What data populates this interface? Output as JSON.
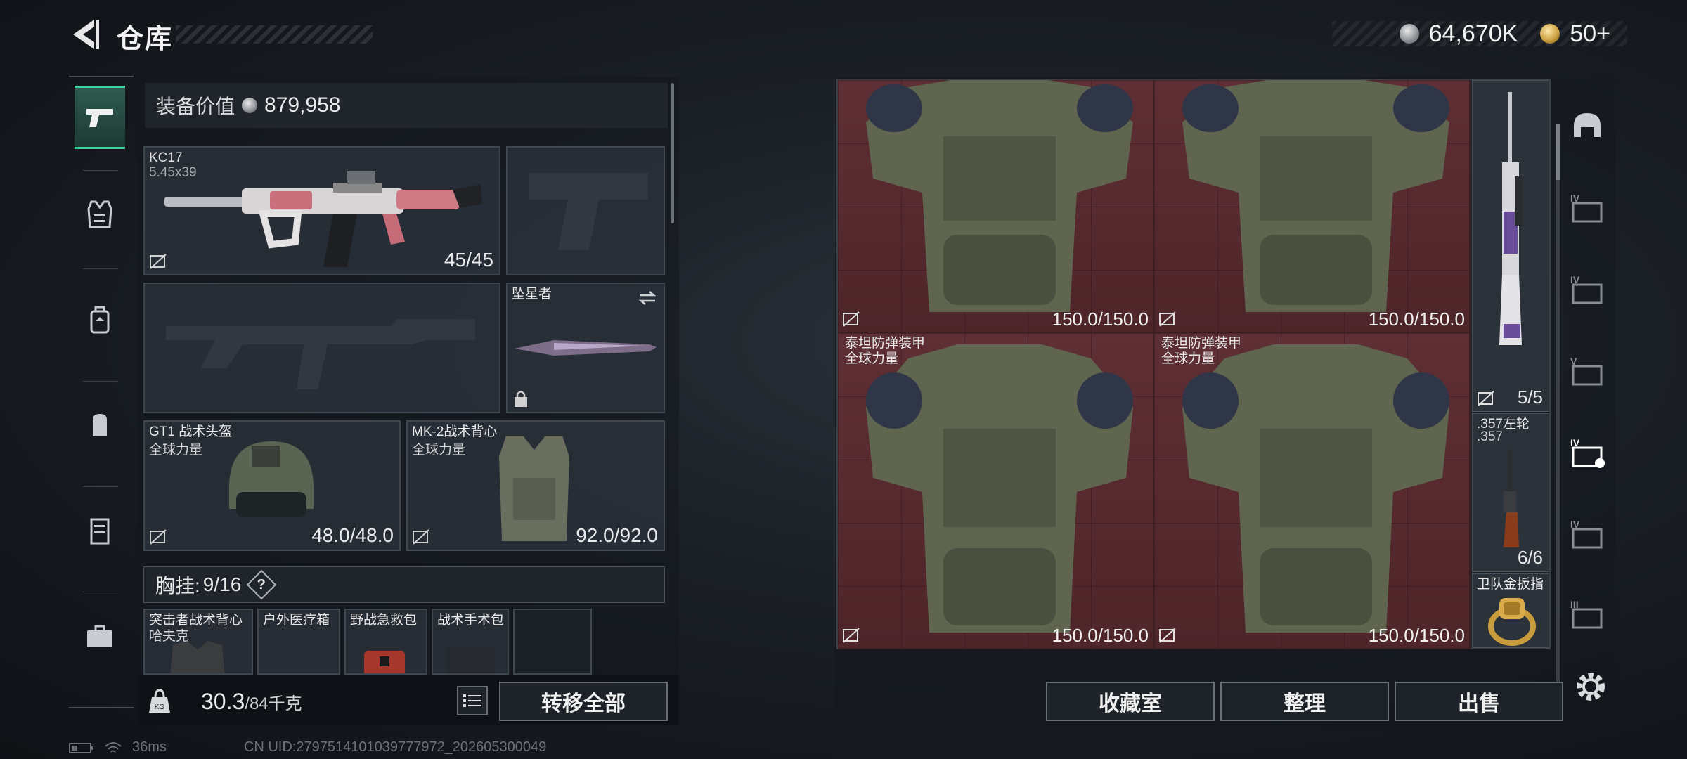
{
  "header": {
    "title": "仓库",
    "currency_silver": "64,670K",
    "currency_gold": "50+"
  },
  "loadout": {
    "value_label": "装备价值",
    "value_amount": "879,958",
    "primary_weapon": {
      "name": "KC17",
      "caliber": "5.45x39",
      "ammo": "45/45"
    },
    "melee": {
      "name": "坠星者"
    },
    "helmet": {
      "name": "GT1 战术头盔",
      "faction": "全球力量",
      "durability": "48.0/48.0"
    },
    "armor": {
      "name": "MK-2战术背心",
      "faction": "全球力量",
      "durability": "92.0/92.0"
    },
    "chest_rig": {
      "label": "胸挂:",
      "count": "9/16",
      "help": "?"
    },
    "rig_items": [
      {
        "name": "突击者战术背心",
        "sub": "哈夫克"
      },
      {
        "name": "户外医疗箱",
        "sub": ""
      },
      {
        "name": "野战急救包",
        "sub": ""
      },
      {
        "name": "战术手术包",
        "sub": ""
      },
      {
        "name": "",
        "sub": ""
      }
    ],
    "weight_current": "30.3",
    "weight_max": "/84千克",
    "transfer_all": "转移全部"
  },
  "storage": {
    "armor_items": [
      {
        "name": "",
        "faction": "",
        "durability": "150.0/150.0"
      },
      {
        "name": "",
        "faction": "",
        "durability": "150.0/150.0"
      },
      {
        "name": "泰坦防弹装甲",
        "faction": "全球力量",
        "durability": "150.0/150.0"
      },
      {
        "name": "泰坦防弹装甲",
        "faction": "全球力量",
        "durability": "150.0/150.0"
      }
    ],
    "sniper": {
      "count": "5/5"
    },
    "revolver": {
      "name": ".357左轮",
      "caliber": ".357",
      "count": "6/6"
    },
    "ring": {
      "name": "卫队金扳指"
    },
    "buttons": {
      "collection": "收藏室",
      "sort": "整理",
      "sell": "出售"
    },
    "tier_labels": [
      "IV",
      "IV",
      "V",
      "IV",
      "IV",
      "III"
    ]
  },
  "status": {
    "ping": "36ms",
    "uid": "CN UID:2797514101039777972_202605300049"
  },
  "colors": {
    "accent": "#3fd3a0",
    "armor_bg": "#5e2f34",
    "panel": "#2d343e"
  }
}
